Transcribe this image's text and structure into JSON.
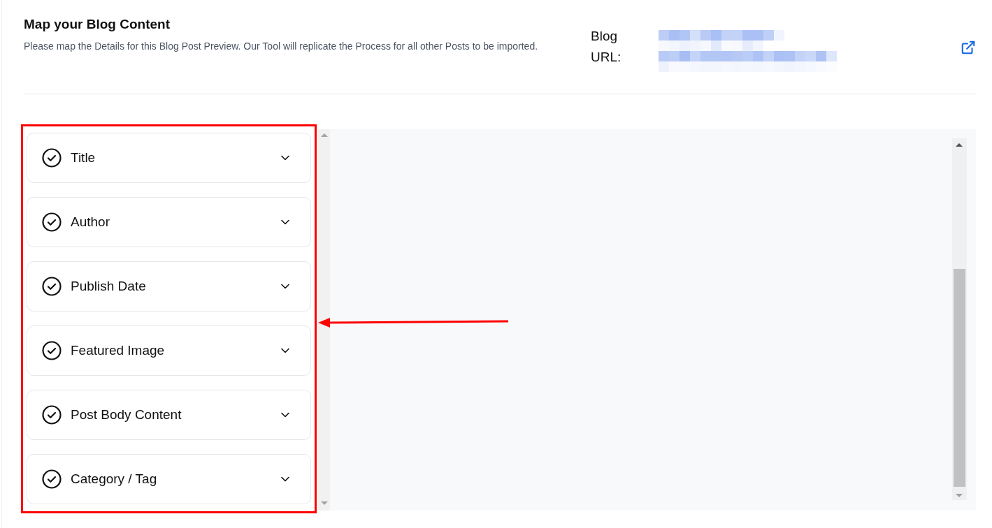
{
  "header": {
    "title": "Map your Blog Content",
    "description": "Please map the Details for this Blog Post Preview. Our Tool will replicate the Process for all other Posts to be imported.",
    "url_label": "Blog URL:"
  },
  "fields": [
    {
      "label": "Title",
      "expanded": false
    },
    {
      "label": "Author",
      "expanded": false
    },
    {
      "label": "Publish Date",
      "expanded": false
    },
    {
      "label": "Featured Image",
      "expanded": false
    },
    {
      "label": "Post Body Content",
      "expanded": false
    },
    {
      "label": "Category / Tag",
      "expanded": false
    }
  ]
}
